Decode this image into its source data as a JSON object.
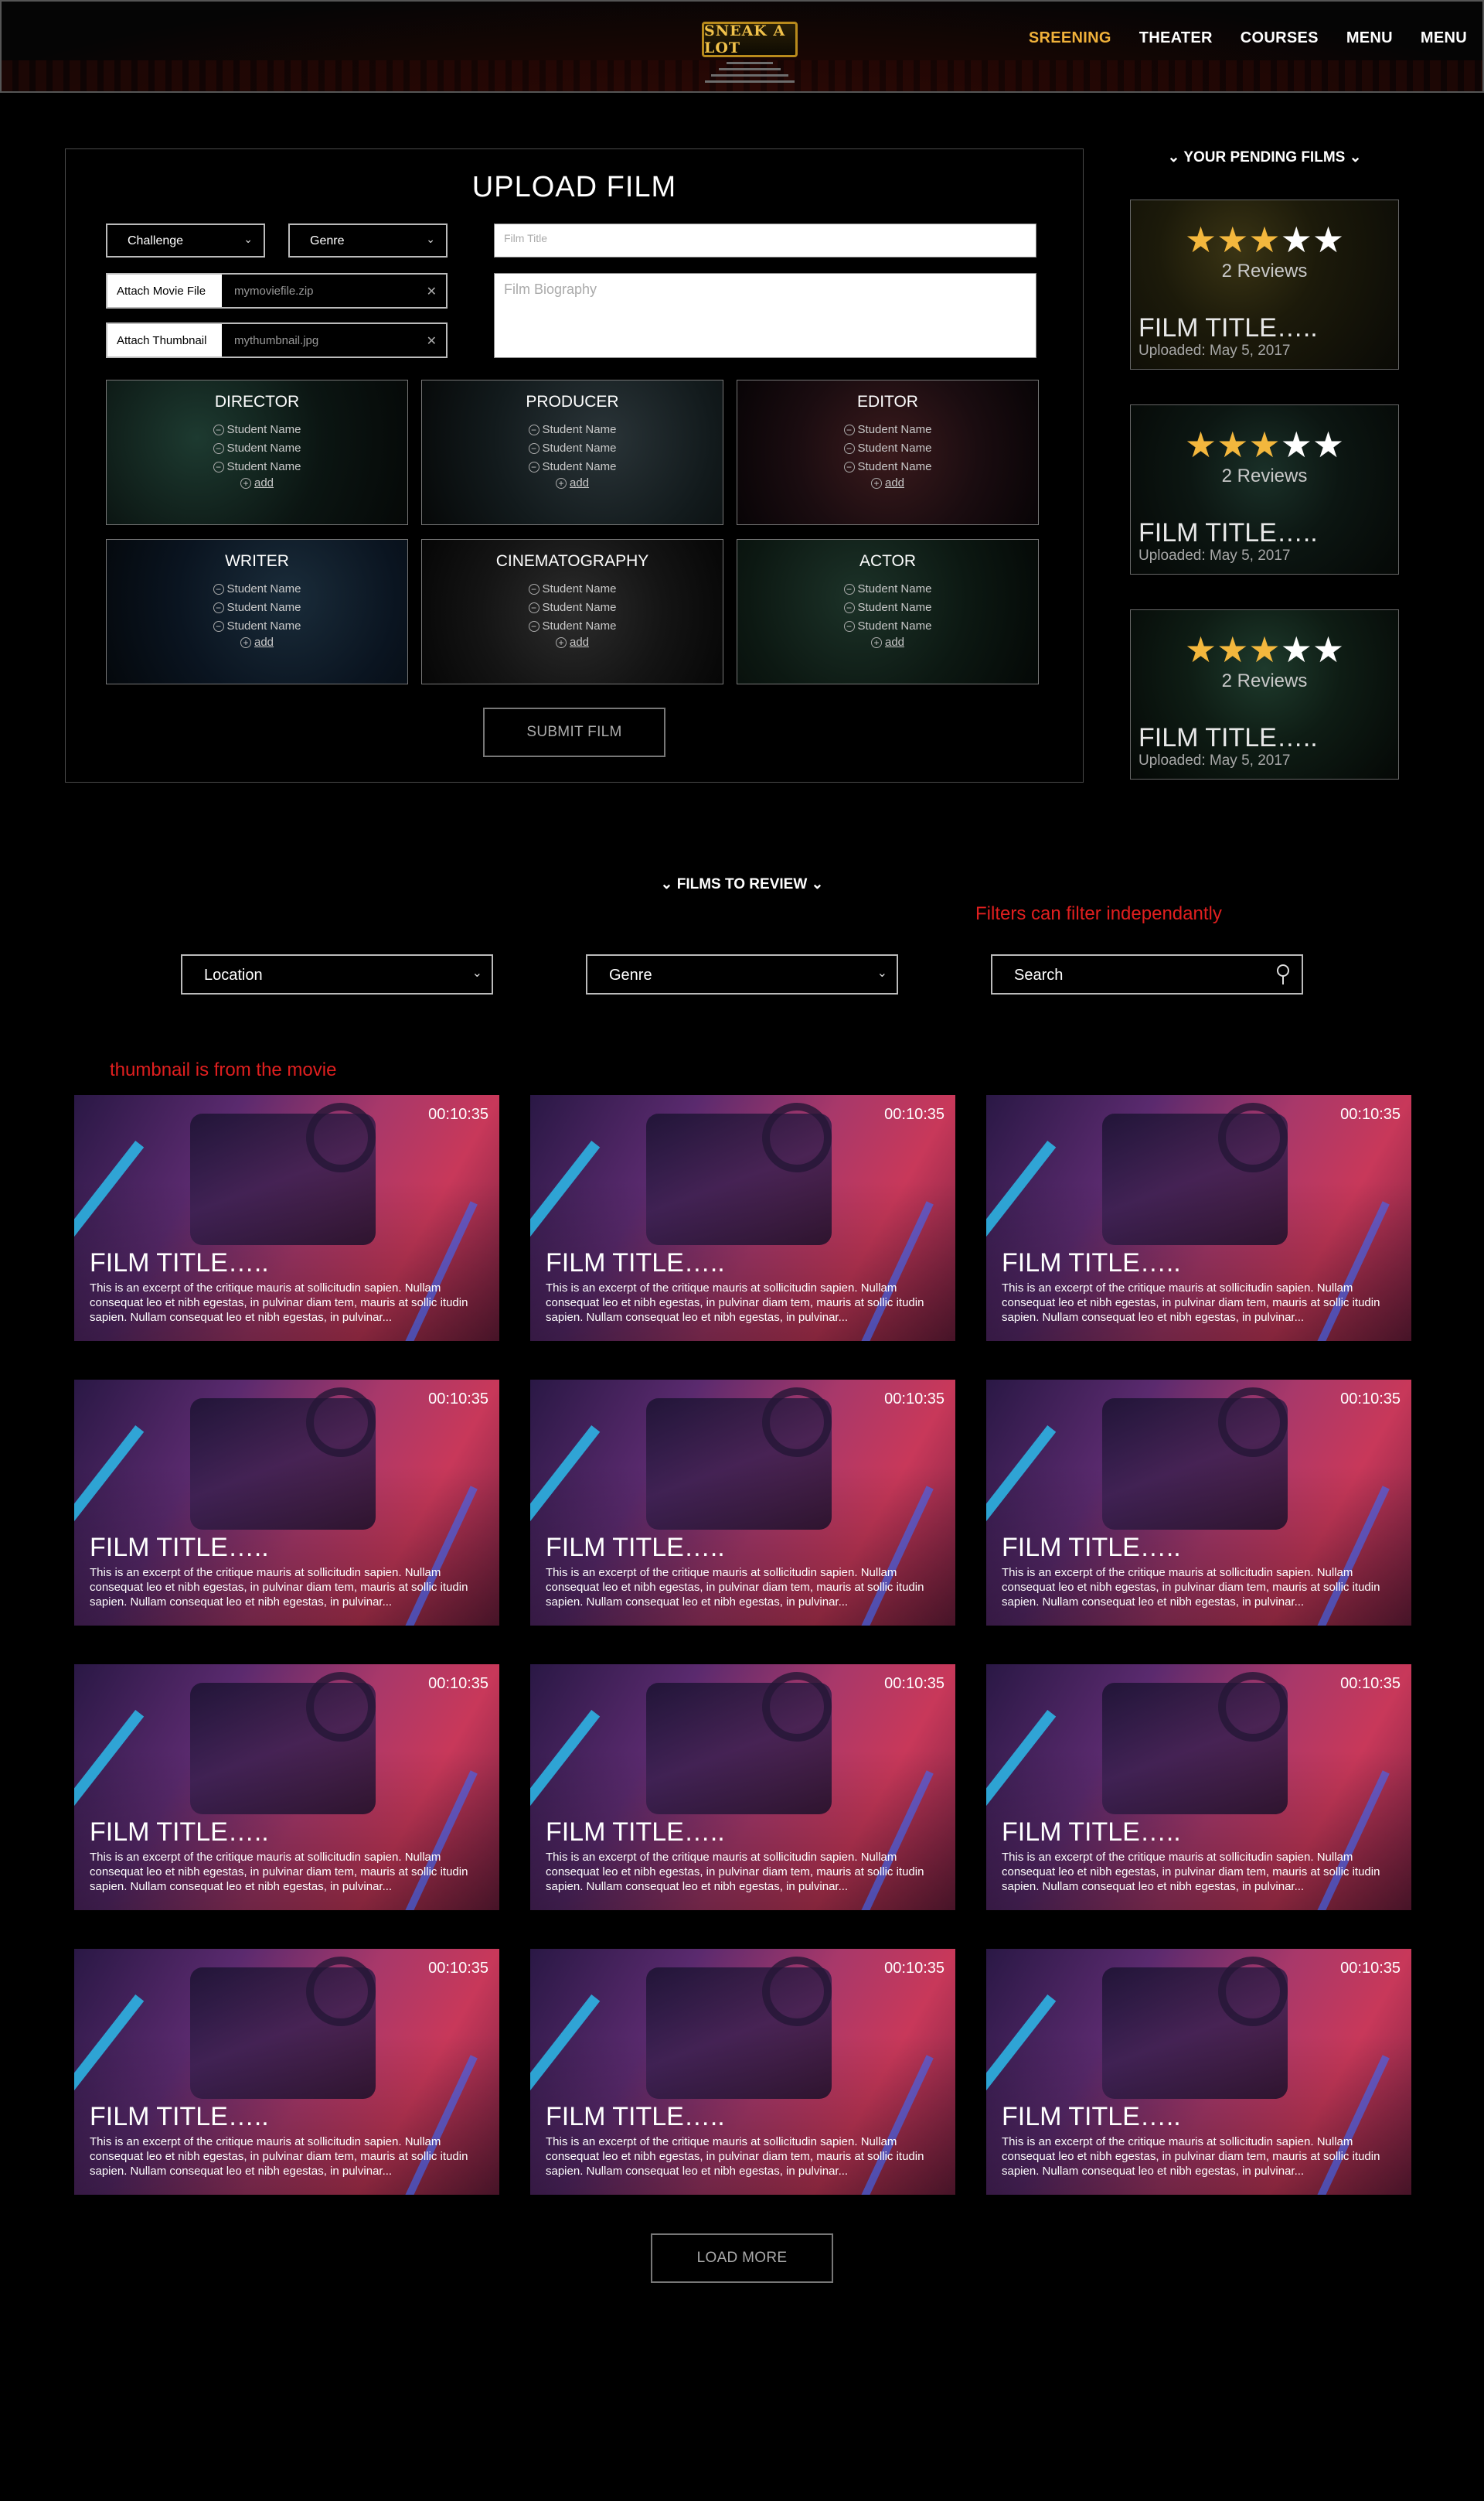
{
  "nav": {
    "logo": "SNEAK A LOT",
    "links": [
      "SREENING",
      "THEATER",
      "COURSES",
      "MENU",
      "MENU"
    ],
    "active_index": 0,
    "accent_color": "#f0b13a"
  },
  "upload": {
    "title": "UPLOAD FILM",
    "challenge_select": "Challenge",
    "genre_select": "Genre",
    "attach_movie_label": "Attach Movie File",
    "attach_movie_value": "mymoviefile.zip",
    "attach_thumb_label": "Attach Thumbnail",
    "attach_thumb_value": "mythumbnail.jpg",
    "film_title_placeholder": "Film Title",
    "film_bio_placeholder": "Film Biography",
    "roles": [
      {
        "title": "DIRECTOR",
        "names": [
          "Student Name",
          "Student Name",
          "Student Name"
        ],
        "add": "add"
      },
      {
        "title": "PRODUCER",
        "names": [
          "Student Name",
          "Student Name",
          "Student Name"
        ],
        "add": "add"
      },
      {
        "title": "EDITOR",
        "names": [
          "Student Name",
          "Student Name",
          "Student Name"
        ],
        "add": "add"
      },
      {
        "title": "WRITER",
        "names": [
          "Student Name",
          "Student Name",
          "Student Name"
        ],
        "add": "add"
      },
      {
        "title": "CINEMATOGRAPHY",
        "names": [
          "Student Name",
          "Student Name",
          "Student Name"
        ],
        "add": "add"
      },
      {
        "title": "ACTOR",
        "names": [
          "Student Name",
          "Student Name",
          "Student Name"
        ],
        "add": "add"
      }
    ],
    "submit_label": "SUBMIT FILM"
  },
  "pending": {
    "heading": "YOUR PENDING FILMS",
    "films": [
      {
        "rating": 3,
        "max": 5,
        "reviews": "2 Reviews",
        "title": "FILM TITLE…..",
        "uploaded": "Uploaded: May 5, 2017"
      },
      {
        "rating": 3,
        "max": 5,
        "reviews": "2 Reviews",
        "title": "FILM TITLE…..",
        "uploaded": "Uploaded: May 5, 2017"
      },
      {
        "rating": 3,
        "max": 5,
        "reviews": "2 Reviews",
        "title": "FILM TITLE…..",
        "uploaded": "Uploaded: May 5, 2017"
      }
    ]
  },
  "review": {
    "heading": "FILMS TO REVIEW",
    "note_filters": "Filters can filter independantly",
    "note_thumbnail": "thumbnail is from the movie",
    "location_select": "Location",
    "genre_select": "Genre",
    "search_placeholder": "Search",
    "load_more_label": "LOAD MORE",
    "cards": [
      {
        "duration": "00:10:35",
        "title": "FILM TITLE…..",
        "excerpt": "This is an excerpt of the critique mauris at sollicitudin sapien. Nullam consequat leo et nibh egestas, in pulvinar diam tem, mauris at sollic itudin sapien. Nullam consequat leo et nibh egestas, in pulvinar..."
      },
      {
        "duration": "00:10:35",
        "title": "FILM TITLE…..",
        "excerpt": "This is an excerpt of the critique mauris at sollicitudin sapien. Nullam consequat leo et nibh egestas, in pulvinar diam tem, mauris at sollic itudin sapien. Nullam consequat leo et nibh egestas, in pulvinar..."
      },
      {
        "duration": "00:10:35",
        "title": "FILM TITLE…..",
        "excerpt": "This is an excerpt of the critique mauris at sollicitudin sapien. Nullam consequat leo et nibh egestas, in pulvinar diam tem, mauris at sollic itudin sapien. Nullam consequat leo et nibh egestas, in pulvinar..."
      },
      {
        "duration": "00:10:35",
        "title": "FILM TITLE…..",
        "excerpt": "This is an excerpt of the critique mauris at sollicitudin sapien. Nullam consequat leo et nibh egestas, in pulvinar diam tem, mauris at sollic itudin sapien. Nullam consequat leo et nibh egestas, in pulvinar..."
      },
      {
        "duration": "00:10:35",
        "title": "FILM TITLE…..",
        "excerpt": "This is an excerpt of the critique mauris at sollicitudin sapien. Nullam consequat leo et nibh egestas, in pulvinar diam tem, mauris at sollic itudin sapien. Nullam consequat leo et nibh egestas, in pulvinar..."
      },
      {
        "duration": "00:10:35",
        "title": "FILM TITLE…..",
        "excerpt": "This is an excerpt of the critique mauris at sollicitudin sapien. Nullam consequat leo et nibh egestas, in pulvinar diam tem, mauris at sollic itudin sapien. Nullam consequat leo et nibh egestas, in pulvinar..."
      },
      {
        "duration": "00:10:35",
        "title": "FILM TITLE…..",
        "excerpt": "This is an excerpt of the critique mauris at sollicitudin sapien. Nullam consequat leo et nibh egestas, in pulvinar diam tem, mauris at sollic itudin sapien. Nullam consequat leo et nibh egestas, in pulvinar..."
      },
      {
        "duration": "00:10:35",
        "title": "FILM TITLE…..",
        "excerpt": "This is an excerpt of the critique mauris at sollicitudin sapien. Nullam consequat leo et nibh egestas, in pulvinar diam tem, mauris at sollic itudin sapien. Nullam consequat leo et nibh egestas, in pulvinar..."
      },
      {
        "duration": "00:10:35",
        "title": "FILM TITLE…..",
        "excerpt": "This is an excerpt of the critique mauris at sollicitudin sapien. Nullam consequat leo et nibh egestas, in pulvinar diam tem, mauris at sollic itudin sapien. Nullam consequat leo et nibh egestas, in pulvinar..."
      },
      {
        "duration": "00:10:35",
        "title": "FILM TITLE…..",
        "excerpt": "This is an excerpt of the critique mauris at sollicitudin sapien. Nullam consequat leo et nibh egestas, in pulvinar diam tem, mauris at sollic itudin sapien. Nullam consequat leo et nibh egestas, in pulvinar..."
      },
      {
        "duration": "00:10:35",
        "title": "FILM TITLE…..",
        "excerpt": "This is an excerpt of the critique mauris at sollicitudin sapien. Nullam consequat leo et nibh egestas, in pulvinar diam tem, mauris at sollic itudin sapien. Nullam consequat leo et nibh egestas, in pulvinar..."
      },
      {
        "duration": "00:10:35",
        "title": "FILM TITLE…..",
        "excerpt": "This is an excerpt of the critique mauris at sollicitudin sapien. Nullam consequat leo et nibh egestas, in pulvinar diam tem, mauris at sollic itudin sapien. Nullam consequat leo et nibh egestas, in pulvinar..."
      }
    ]
  },
  "icons": {
    "chevron": "chevron-down-icon",
    "close": "close-icon",
    "minus": "minus-circle-icon",
    "plus": "plus-circle-icon",
    "star": "star-icon",
    "search": "search-icon"
  }
}
